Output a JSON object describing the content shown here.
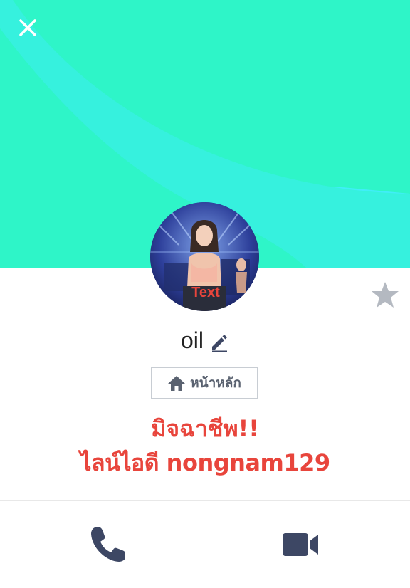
{
  "profile": {
    "name": "oil",
    "home_label": "หน้าหลัก",
    "status_line1": "มิจฉาชีพ!!",
    "status_line2": "ไลน์ไอดี nongnam129",
    "avatar_overlay_text": "Text"
  },
  "icons": {
    "close": "close-icon",
    "star": "star-icon",
    "edit": "pencil-icon",
    "home": "home-icon",
    "call": "phone-icon",
    "video": "video-camera-icon"
  },
  "colors": {
    "header_cyan": "#44f2ff",
    "header_green": "#2ef5c8",
    "status_red": "#e8453c",
    "icon_dark": "#3d4764",
    "star_gray": "#b4b9c1"
  }
}
